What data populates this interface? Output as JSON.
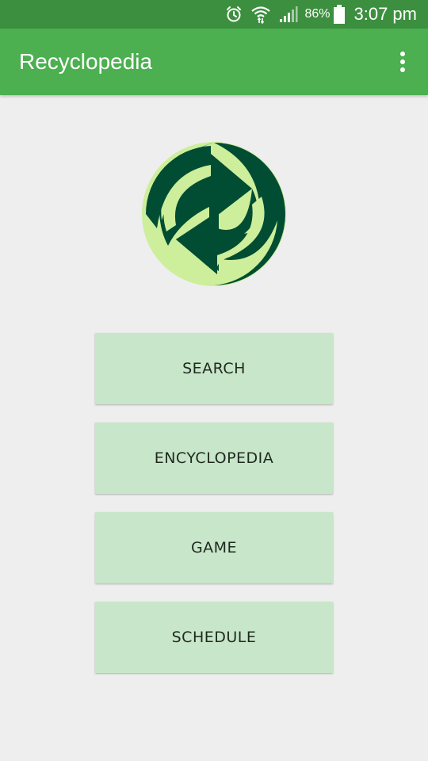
{
  "status_bar": {
    "battery": "86%",
    "time": "3:07 pm",
    "icons": [
      "alarm-icon",
      "wifi-icon",
      "signal-icon",
      "battery-icon"
    ]
  },
  "app_bar": {
    "title": "Recyclopedia",
    "overflow_icon": "more-vert-icon"
  },
  "logo": {
    "icon": "green-dot-recycle-logo",
    "colors": {
      "dark": "#004d33",
      "light": "#cdee9a"
    }
  },
  "menu": {
    "search": "SEARCH",
    "encyclopedia": "ENCYCLOPEDIA",
    "game": "GAME",
    "schedule": "SCHEDULE"
  },
  "colors": {
    "status_bar": "#3c8f3f",
    "app_bar": "#4caf50",
    "background": "#eeeeee",
    "button": "#c8e6c9"
  }
}
